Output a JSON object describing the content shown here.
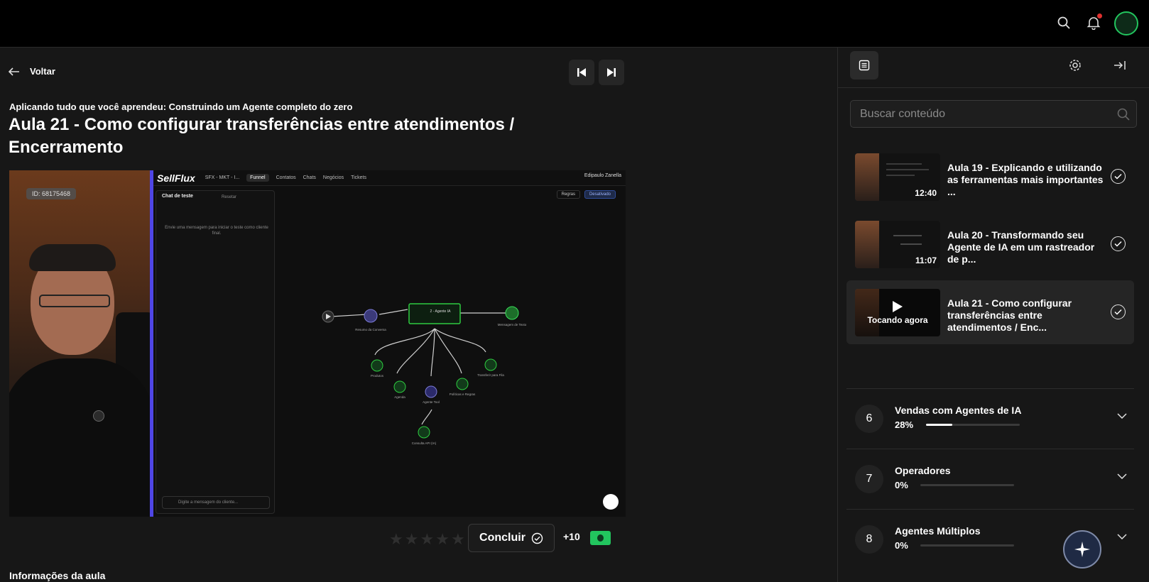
{
  "topbar": {
    "search_icon": "search-icon",
    "notification_icon": "bell-icon",
    "notification_dot_color": "#e0312f",
    "avatar_ring_color": "#22c55e"
  },
  "main": {
    "back_label": "Voltar",
    "module_subtitle": "Aplicando tudo que você aprendeu: Construindo um Agente completo do zero",
    "lesson_title": "Aula 21 - Como configurar transferências entre atendimentos / Encerramento",
    "info_heading": "Informações da aula"
  },
  "video": {
    "id_badge": "ID: 68175468",
    "app_brand": "SellFlux",
    "app_nav": [
      "SFX - MKT - I...",
      "Funnel",
      "Contatos",
      "Chats",
      "Negócios",
      "Tickets"
    ],
    "app_user": "Edipaulo Zanella",
    "chat_title": "Chat de teste",
    "chat_reset": "Resetar",
    "chat_hint": "Envie uma mensagem para iniciar o teste como cliente final.",
    "chat_placeholder": "Digite a mensagem do cliente...",
    "canvas_rules": "Regras",
    "canvas_status": "Desativado",
    "flow_nodes": [
      "Resumo da Conversa",
      "2 - Agente IA",
      "Mensagem de Texto",
      "Produtos",
      "Agenda",
      "Agente Tool",
      "Políticas e Regras",
      "Transferir para Fila",
      "Consulta API (IA)"
    ]
  },
  "actions": {
    "rating_stars": 5,
    "rating_value": 0,
    "complete_label": "Concluir",
    "points": "+10",
    "accent_color": "#22c55e"
  },
  "sidebar": {
    "search_placeholder": "Buscar conteúdo",
    "lessons": [
      {
        "title": "Aula 19 - Explicando e utilizando as ferramentas mais importantes ...",
        "duration": "12:40",
        "completed": true
      },
      {
        "title": "Aula 20 - Transformando seu Agente de IA em um rastreador de p...",
        "duration": "11:07",
        "completed": true
      },
      {
        "title": "Aula 21 - Como configurar transferências entre atendimentos / Enc...",
        "now_playing": "Tocando agora",
        "completed": true
      }
    ],
    "modules": [
      {
        "number": "6",
        "title": "Vendas com Agentes de IA",
        "progress_label": "28%",
        "progress": 0.28
      },
      {
        "number": "7",
        "title": "Operadores",
        "progress_label": "0%",
        "progress": 0
      },
      {
        "number": "8",
        "title": "Agentes Múltiplos",
        "progress_label": "0%",
        "progress": 0
      }
    ]
  }
}
